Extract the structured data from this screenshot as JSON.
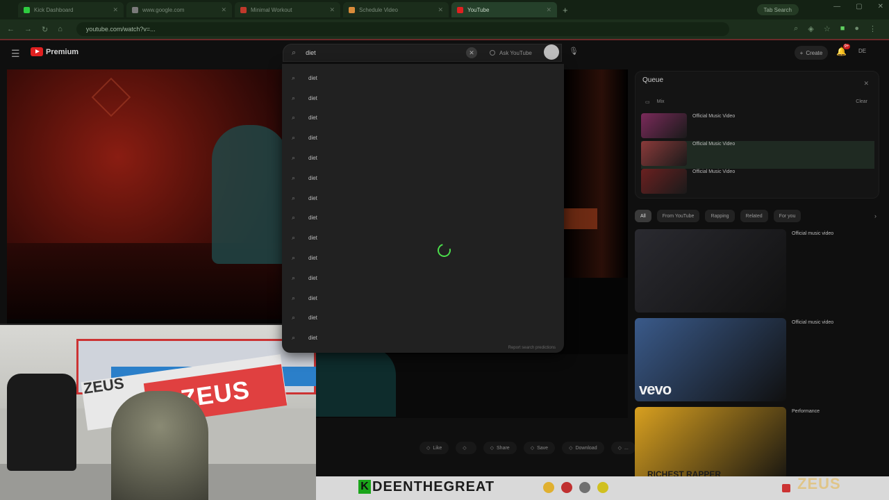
{
  "browser": {
    "tabs": [
      {
        "label": "Kick Dashboard",
        "favicon_color": "#2ecc40",
        "active": false
      },
      {
        "label": "www.google.com",
        "favicon_color": "#7a7a7a",
        "active": false
      },
      {
        "label": "Minimal Workout",
        "favicon_color": "#c0392b",
        "active": false
      },
      {
        "label": "Schedule Video",
        "favicon_color": "#d98c3a",
        "active": false
      },
      {
        "label": "YouTube",
        "favicon_color": "#e02020",
        "active": true
      }
    ],
    "new_tab_symbol": "+",
    "tab_search_label": "Tab Search",
    "url": "youtube.com/watch?v=..."
  },
  "youtube": {
    "logo_text": "Premium",
    "search_query": "diet",
    "search_button_label": "Ask YouTube",
    "create_label": "Create",
    "notification_count": "9+",
    "avatar_label": "DE"
  },
  "suggestions": [
    "diet",
    "diet",
    "diet",
    "diet",
    "diet",
    "diet",
    "diet",
    "diet",
    "diet",
    "diet",
    "diet",
    "diet",
    "diet",
    "diet"
  ],
  "suggest_footer": "Report search predictions",
  "video_actions": [
    "Like",
    "",
    "Share",
    "Save",
    "Download",
    "..."
  ],
  "queue": {
    "title": "Queue",
    "subtitle": "Mix",
    "filter_label": "Clear",
    "items": [
      {
        "title": "Official Music Video",
        "channel": "",
        "thumb_color": "#7a2a5a"
      },
      {
        "title": "Official Music Video",
        "channel": "",
        "thumb_color": "#8a3a3a"
      },
      {
        "title": "Official Music Video",
        "channel": "",
        "thumb_color": "#6a2020"
      }
    ]
  },
  "chips": [
    "All",
    "From YouTube",
    "Rapping",
    "Related",
    "For you"
  ],
  "recommendations": [
    {
      "title": "Official music video",
      "channel": "",
      "thumb_color": "#2a2a30"
    },
    {
      "title": "Official music video",
      "channel": "",
      "thumb_color": "#3a5a8a",
      "badge": "vevo"
    },
    {
      "title": "Performance",
      "channel": "",
      "thumb_color": "#d8a020",
      "thumb_text": "RICHEST RAPPER"
    }
  ],
  "stream": {
    "k_badge": "K",
    "streamer_name": "DEENTHEGREAT",
    "brand": "ZEUS",
    "banner_left": "ZEUS",
    "banner_right": "ZEUS"
  }
}
